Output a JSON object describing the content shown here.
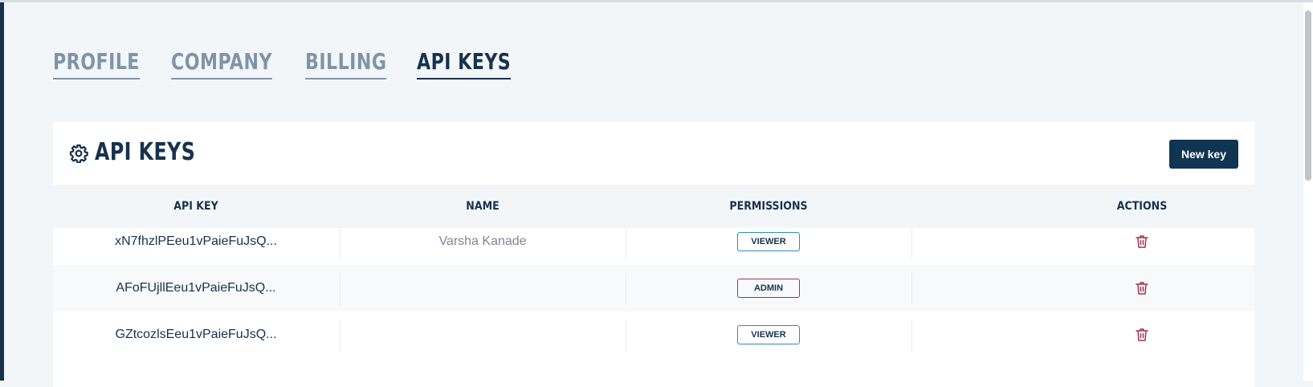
{
  "tabs": [
    "PROFILE",
    "COMPANY",
    "BILLING",
    "API KEYS"
  ],
  "active_tab_index": 3,
  "card": {
    "title": "API KEYS",
    "icon": "gear-icon",
    "new_key_label": "New key"
  },
  "table": {
    "columns": [
      "API KEY",
      "NAME",
      "PERMISSIONS",
      "ACTIONS"
    ],
    "rows": [
      {
        "api_key": "xN7fhzlPEeu1vPaieFuJsQ...",
        "name": "Varsha Kanade",
        "permission": "VIEWER"
      },
      {
        "api_key": "AFoFUjllEeu1vPaieFuJsQ...",
        "name": "",
        "permission": "ADMIN"
      },
      {
        "api_key": "GZtcozlsEeu1vPaieFuJsQ...",
        "name": "",
        "permission": "VIEWER"
      }
    ],
    "action_icon": "trash-icon"
  },
  "colors": {
    "primary": "#17324d",
    "button": "#0f3553",
    "inactive_tab": "#7f94a8",
    "viewer_badge": "#2f8fb3",
    "admin_badge": "#a0344b",
    "delete_icon": "#a0344b",
    "page_background": "#f3f6f9"
  }
}
